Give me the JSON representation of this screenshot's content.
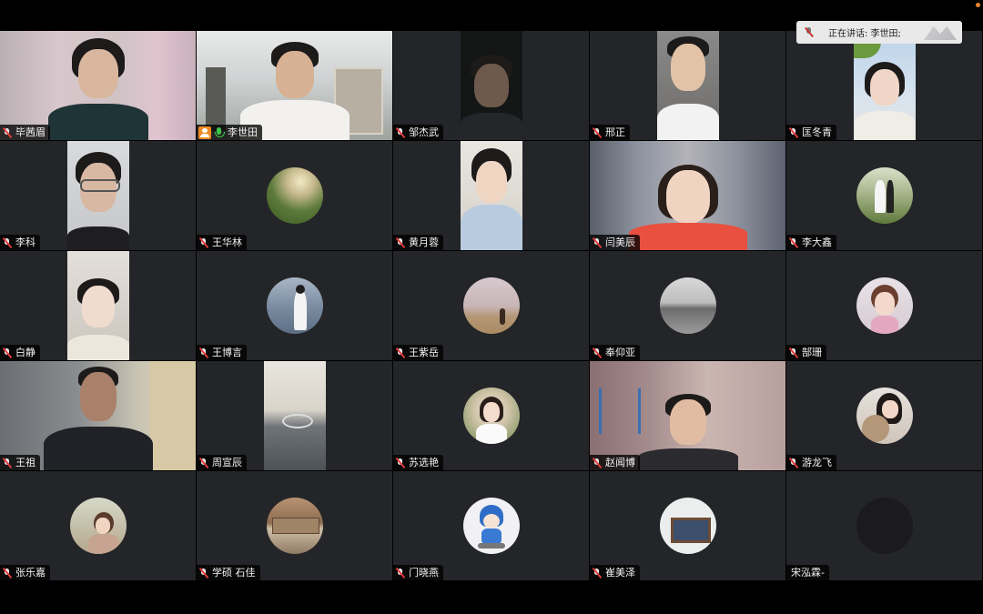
{
  "speaking_indicator": {
    "label": "正在讲话: 李世田;"
  },
  "participants": [
    {
      "name": "毕茜眉",
      "mic": "muted"
    },
    {
      "name": "李世田",
      "mic": "active",
      "host": true,
      "speaking": true
    },
    {
      "name": "邹杰武",
      "mic": "muted"
    },
    {
      "name": "邢正",
      "mic": "muted"
    },
    {
      "name": "匡冬青",
      "mic": "muted"
    },
    {
      "name": "李科",
      "mic": "muted"
    },
    {
      "name": "王华林",
      "mic": "muted"
    },
    {
      "name": "黄月蓉",
      "mic": "muted"
    },
    {
      "name": "闫美辰",
      "mic": "muted"
    },
    {
      "name": "李大鑫",
      "mic": "muted"
    },
    {
      "name": "白静",
      "mic": "muted"
    },
    {
      "name": "王博言",
      "mic": "muted"
    },
    {
      "name": "王紫岳",
      "mic": "muted"
    },
    {
      "name": "奉仰亚",
      "mic": "muted"
    },
    {
      "name": "郜珊",
      "mic": "muted"
    },
    {
      "name": "王祖",
      "mic": "muted"
    },
    {
      "name": "周宣辰",
      "mic": "muted"
    },
    {
      "name": "苏选艳",
      "mic": "muted"
    },
    {
      "name": "赵闻博",
      "mic": "muted"
    },
    {
      "name": "游龙飞",
      "mic": "muted"
    },
    {
      "name": "张乐嘉",
      "mic": "muted"
    },
    {
      "name": "学硕 石佳",
      "mic": "muted"
    },
    {
      "name": "门晓燕",
      "mic": "muted"
    },
    {
      "name": "崔美泽",
      "mic": "muted"
    },
    {
      "name": "宋泓霖-",
      "mic": "muted"
    }
  ],
  "colors": {
    "speaking_border": "#3ec84b",
    "host_badge": "#f08a24",
    "muted_slash": "#e23b3b"
  }
}
